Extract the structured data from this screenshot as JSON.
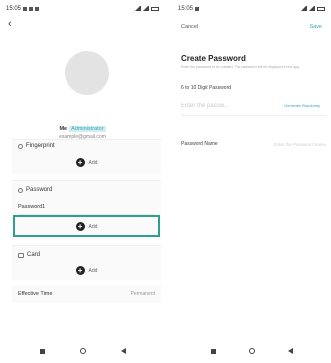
{
  "left_screen": {
    "status_time": "15:05",
    "back_icon": "chevron-left-icon",
    "user": {
      "name": "Me",
      "badge": "Administrator",
      "email": "example@gmail.com"
    },
    "fingerprint": {
      "label": "Fingerprint",
      "add_label": "Add"
    },
    "password": {
      "label": "Password",
      "item": "Password1",
      "add_label": "Add"
    },
    "card": {
      "label": "Card",
      "add_label": "Add"
    },
    "effective_time": {
      "label": "Effective Time",
      "value": "Permanent"
    }
  },
  "right_screen": {
    "status_time": "15:05",
    "cancel_label": "Cancel",
    "save_label": "Save",
    "title": "Create Password",
    "description": "Enter the password to be created. The password will be displayed in the app.",
    "hint": "6 to 10 Digit Password",
    "password_placeholder": "Enter the passw...",
    "generate_label": "Generate Randomly",
    "name_label": "Password Name",
    "name_placeholder": "Enter the Password Name"
  },
  "colors": {
    "accent": "#3aa3b5",
    "highlight_border": "#2e9e8e",
    "card_background": "#fafafa"
  }
}
